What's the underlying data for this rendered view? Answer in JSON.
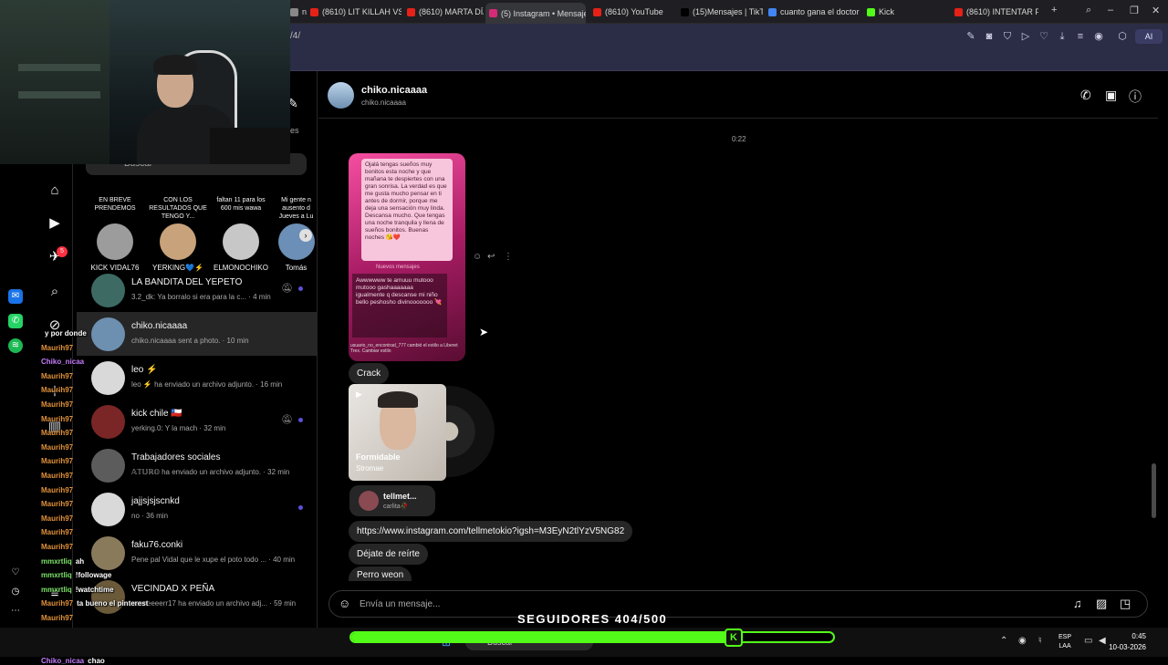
{
  "browser": {
    "tabs": [
      {
        "label": "nza",
        "fav": "#888"
      },
      {
        "label": "(8610) LIT KILLAH VS",
        "fav": "#e62117"
      },
      {
        "label": "(8610) MARTA DÍAZ V",
        "fav": "#e62117"
      },
      {
        "label": "(5) Instagram • Mensajes",
        "fav": "#d62976",
        "active": true
      },
      {
        "label": "(8610) YouTube",
        "fav": "#e62117"
      },
      {
        "label": "(15)Mensajes | TikTok",
        "fav": "#000"
      },
      {
        "label": "cuanto gana el doctor",
        "fav": "#4285f4"
      },
      {
        "label": "Kick",
        "fav": "#53fc18"
      },
      {
        "label": "(8610) INTENTAR FRE",
        "fav": "#e62117"
      }
    ],
    "url": "/4/",
    "ai_label": "AI"
  },
  "nav": {
    "notifications_badge": "5"
  },
  "search": {
    "placeholder": "Buscar"
  },
  "partial_header_text": "es",
  "notes": [
    {
      "bubble": "EN BREVE PRENDEMOS",
      "name": "KICK VIDAL76",
      "color": "#9c9c9c"
    },
    {
      "bubble": "CON LOS RESULTADOS QUE TENGO Y...",
      "name": "YERKING💙⚡",
      "color": "#c8a27a"
    },
    {
      "bubble": "faltan 11 para los 600 mis wawa",
      "name": "ELMONOCHIKO",
      "color": "#c7c7c7"
    },
    {
      "bubble": "Mi gente n ausento d Jueves a Lu",
      "name": "Tomás",
      "color": "#6b8fb6"
    }
  ],
  "conversations": [
    {
      "name": "LA BANDITA DEL YEPETO",
      "preview": "3.2_dk: Ya borralo si era para la c... · 4 min",
      "muted": true,
      "unread": true,
      "color": "#3d6b63"
    },
    {
      "name": "chiko.nicaaaa",
      "preview": "chiko.nicaaaa sent a photo. · 10 min",
      "muted": false,
      "unread": false,
      "selected": true,
      "color": "#6d8fb0"
    },
    {
      "name": "leo ⚡",
      "preview": "leo ⚡ ha enviado un archivo adjunto. · 16 min",
      "muted": false,
      "unread": false,
      "color": "#d9d9d9"
    },
    {
      "name": "kick chile 🇨🇱",
      "preview": "yerking.0: Y la mach · 32 min",
      "muted": true,
      "unread": true,
      "color": "#7a2626"
    },
    {
      "name": "Trabajadores sociales",
      "preview": "𝔸𝕋𝕌ℝ𝕆 ha enviado un archivo adjunto. · 32 min",
      "muted": false,
      "unread": false,
      "color": "#5c5c5c"
    },
    {
      "name": "jajjsjsjscnkd",
      "preview": "no · 36 min",
      "muted": false,
      "unread": true,
      "color": "#d9d9d9"
    },
    {
      "name": "faku76.conki",
      "preview": "Pene pal Vidal que le xupe el poto todo ... · 40 min",
      "muted": false,
      "unread": false,
      "color": "#8a7a5c"
    },
    {
      "name": "VECINDAD X PEÑA",
      "preview": "usseeeeerr17 ha enviado un archivo adj... · 59 min",
      "muted": false,
      "unread": false,
      "color": "#6a5a3a"
    }
  ],
  "chat": {
    "name": "chiko.nicaaaa",
    "username": "chiko.nicaaaa",
    "timestamp": "0:22",
    "photo_text_top": "Ojalá tengas sueños muy bonitos esta noche y que mañana te despiertes con una gran sonrisa. La verdad es que me gusta mucho pensar en ti antes de dormir, porque me deja una sensación muy linda. Descansa mucho. Que tengas una noche tranquila y llena de sueños bonitos. Buenas noches 😘❤️",
    "photo_text_divider": "Nuevos mensajes",
    "photo_text_bottom": "Awwwwww te amuuu mutooo mutooo gashaaaaaaa igualmente q descanse mi niño bello peshosho divinooooooo 💘",
    "photo_footer": "usuario_no_encontrad_777 cambió el estilo a Liberet Trex. Cambiar estilo",
    "messages": [
      "Crack",
      "https://www.instagram.com/tellmetokio?igsh=M3EyN2tlYzV5NG82",
      "Déjate de reírte",
      "Perro weon"
    ],
    "music": {
      "title": "Formidable",
      "artist": "Stromae"
    },
    "shared_profile": {
      "name": "tellmet...",
      "subtitle": "carlita🥀"
    },
    "composer_placeholder": "Envía un mensaje..."
  },
  "stream_chat": [
    {
      "user": "",
      "msg": "y por donde"
    },
    {
      "user": "Maurih97",
      "msg": ""
    },
    {
      "user": "Chiko_nicaa",
      "msg": ""
    },
    {
      "user": "Maurih97",
      "msg": ""
    },
    {
      "user": "Maurih97",
      "msg": ""
    },
    {
      "user": "Maurih97",
      "msg": ""
    },
    {
      "user": "Maurih97",
      "msg": ""
    },
    {
      "user": "Maurih97",
      "msg": ""
    },
    {
      "user": "Maurih97",
      "msg": ""
    },
    {
      "user": "Maurih97",
      "msg": ""
    },
    {
      "user": "Maurih97",
      "msg": ""
    },
    {
      "user": "Maurih97",
      "msg": ""
    },
    {
      "user": "Maurih97",
      "msg": ""
    },
    {
      "user": "Maurih97",
      "msg": ""
    },
    {
      "user": "Maurih97",
      "msg": ""
    },
    {
      "user": "Maurih97",
      "msg": ""
    },
    {
      "user": "mmxrtliq",
      "msg": "ah"
    },
    {
      "user": "mmxrtliq",
      "msg": "!followage"
    },
    {
      "user": "mmxrtliq",
      "msg": "!watchtime"
    },
    {
      "user": "Maurih97",
      "msg": "ta bueno el pinterest"
    },
    {
      "user": "Maurih97",
      "msg": ""
    },
    {
      "user": "mmxrtliq",
      "msg": "!puntos"
    },
    {
      "user": "Chiko_nicaa",
      "msg": "nooo"
    },
    {
      "user": "Chiko_nicaa",
      "msg": "chao"
    }
  ],
  "followers": {
    "label": "SEGUIDORES 404/500",
    "current": 404,
    "goal": 500
  },
  "taskbar": {
    "search": "Buscar",
    "lang_top": "ESP",
    "lang_bottom": "LAA",
    "time": "0:45",
    "date": "10-03-2026"
  },
  "colors": {
    "accent": "#5b51d8",
    "kick": "#53fc18",
    "bg": "#000000",
    "bubble": "#262626"
  }
}
